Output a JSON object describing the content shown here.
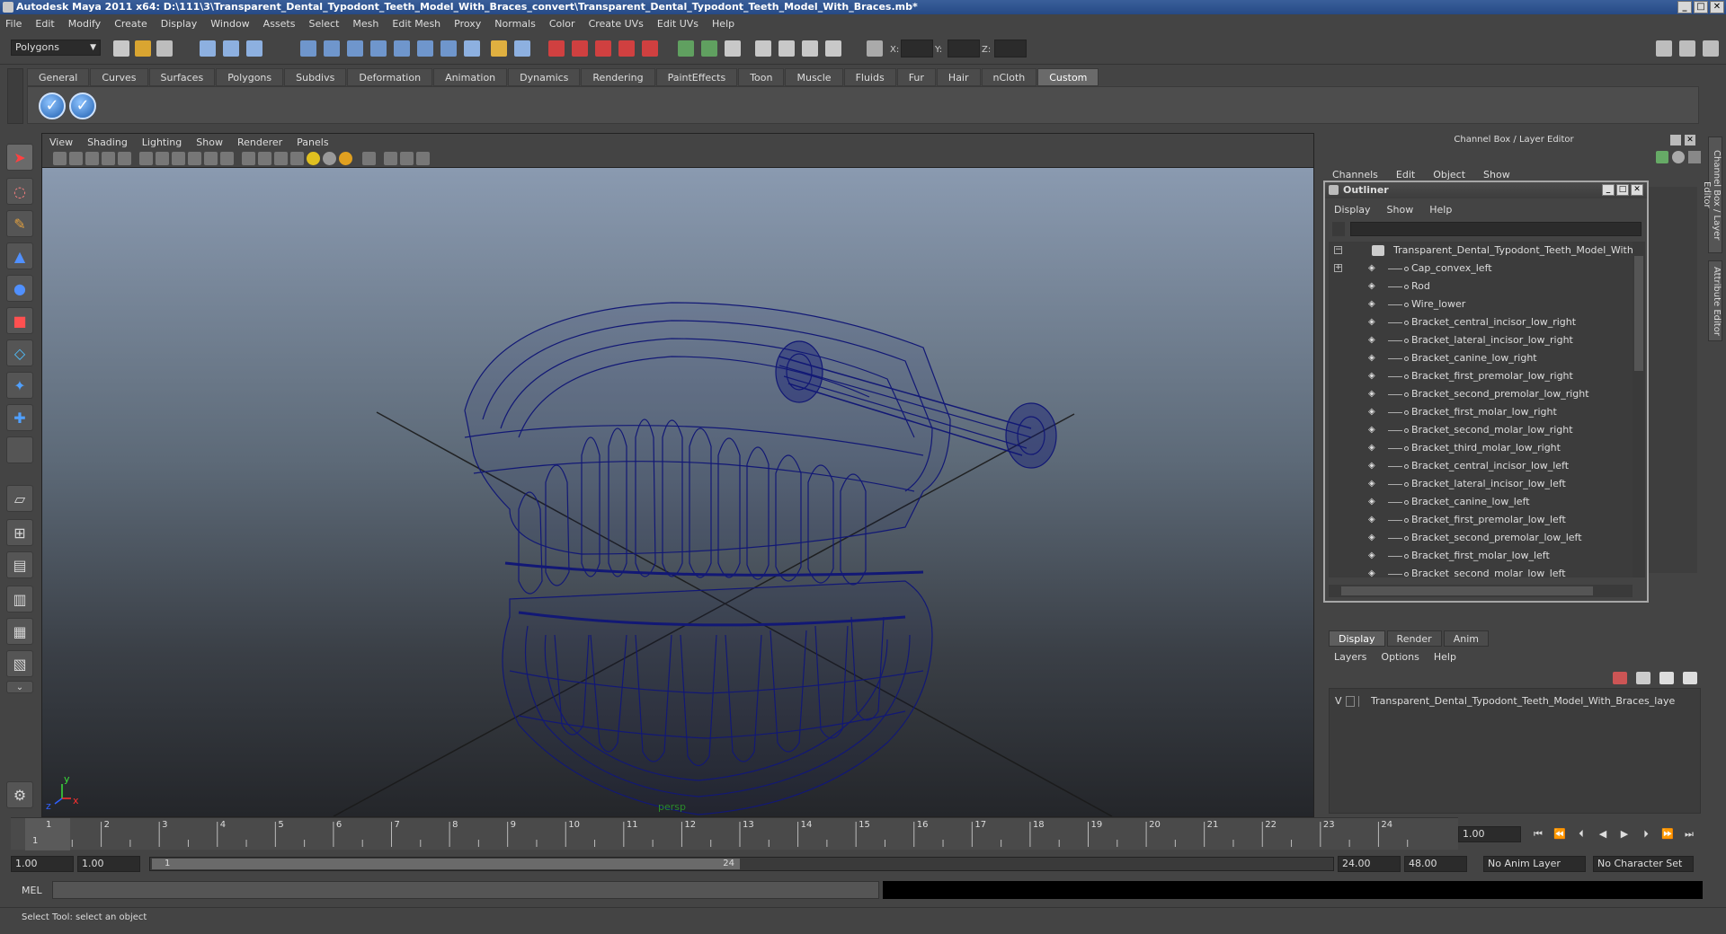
{
  "window": {
    "title": "Autodesk Maya 2011 x64: D:\\111\\3\\Transparent_Dental_Typodont_Teeth_Model_With_Braces_convert\\Transparent_Dental_Typodont_Teeth_Model_With_Braces.mb*",
    "minimize": "_",
    "maximize": "□",
    "close": "✕"
  },
  "menubar": [
    "File",
    "Edit",
    "Modify",
    "Create",
    "Display",
    "Window",
    "Assets",
    "Select",
    "Mesh",
    "Edit Mesh",
    "Proxy",
    "Normals",
    "Color",
    "Create UVs",
    "Edit UVs",
    "Help"
  ],
  "status": {
    "mode": "Polygons",
    "x_label": "X:",
    "y_label": "Y:",
    "z_label": "Z:"
  },
  "shelf": {
    "tabs": [
      "General",
      "Curves",
      "Surfaces",
      "Polygons",
      "Subdivs",
      "Deformation",
      "Animation",
      "Dynamics",
      "Rendering",
      "PaintEffects",
      "Toon",
      "Muscle",
      "Fluids",
      "Fur",
      "Hair",
      "nCloth",
      "Custom"
    ],
    "active_tab": "Custom"
  },
  "viewport": {
    "menu": [
      "View",
      "Shading",
      "Lighting",
      "Show",
      "Renderer",
      "Panels"
    ],
    "camera_label": "persp",
    "wire_color": "#121875",
    "axis_y": "y",
    "axis_x": "x",
    "axis_z": "z"
  },
  "channel_box": {
    "header": "Channel Box / Layer Editor",
    "menu": [
      "Channels",
      "Edit",
      "Object",
      "Show"
    ]
  },
  "side_tabs": {
    "channel_box": "Channel Box / Layer Editor",
    "attribute_editor": "Attribute Editor"
  },
  "outliner": {
    "title": "Outliner",
    "menu": [
      "Display",
      "Show",
      "Help"
    ],
    "items": [
      "Transparent_Dental_Typodont_Teeth_Model_With_Bra",
      "Cap_convex_left",
      "Rod",
      "Wire_lower",
      "Bracket_central_incisor_low_right",
      "Bracket_lateral_incisor_low_right",
      "Bracket_canine_low_right",
      "Bracket_first_premolar_low_right",
      "Bracket_second_premolar_low_right",
      "Bracket_first_molar_low_right",
      "Bracket_second_molar_low_right",
      "Bracket_third_molar_low_right",
      "Bracket_central_incisor_low_left",
      "Bracket_lateral_incisor_low_left",
      "Bracket_canine_low_left",
      "Bracket_first_premolar_low_left",
      "Bracket_second_premolar_low_left",
      "Bracket_first_molar_low_left",
      "Bracket_second_molar_low_left"
    ]
  },
  "layer_editor": {
    "tabs": [
      "Display",
      "Render",
      "Anim"
    ],
    "active_tab": "Display",
    "menu": [
      "Layers",
      "Options",
      "Help"
    ],
    "layer_name": "Transparent_Dental_Typodont_Teeth_Model_With_Braces_laye",
    "layer_visible": "V"
  },
  "timeline": {
    "ticks": [
      "1",
      "2",
      "3",
      "4",
      "5",
      "6",
      "7",
      "8",
      "9",
      "10",
      "11",
      "12",
      "13",
      "14",
      "15",
      "16",
      "17",
      "18",
      "19",
      "20",
      "21",
      "22",
      "23",
      "24"
    ],
    "current_frame": "1.00",
    "current_marker": "1"
  },
  "range": {
    "start": "1.00",
    "playback_start": "1.00",
    "thumb_start": "1",
    "thumb_end": "24",
    "playback_end": "24.00",
    "end": "48.00",
    "anim_layer": "No Anim Layer",
    "character_set": "No Character Set"
  },
  "command": {
    "label": "MEL"
  },
  "help": {
    "text": "Select Tool: select an object"
  }
}
